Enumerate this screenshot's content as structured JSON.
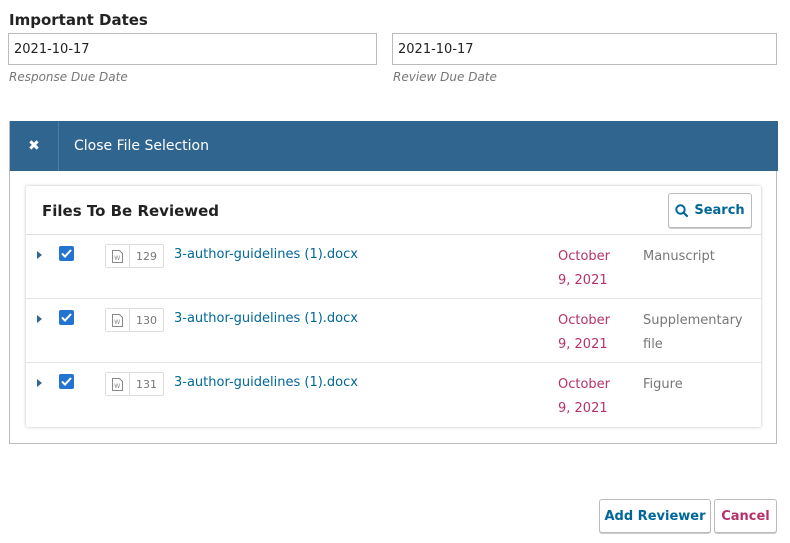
{
  "dates": {
    "title": "Important Dates",
    "response_due": {
      "value": "2021-10-17",
      "help": "Response Due Date"
    },
    "review_due": {
      "value": "2021-10-17",
      "help": "Review Due Date"
    }
  },
  "file_selection": {
    "close_label": "Close File Selection",
    "close_icon": "times-icon",
    "title": "Files To Be Reviewed",
    "search_label": "Search",
    "files": [
      {
        "id": "129",
        "name": "3-author-guidelines (1).docx",
        "date_line1": "October",
        "date_line2": "9, 2021",
        "type_line1": "Manuscript",
        "type_line2": "",
        "checked": true
      },
      {
        "id": "130",
        "name": "3-author-guidelines (1).docx",
        "date_line1": "October",
        "date_line2": "9, 2021",
        "type_line1": "Supplementary",
        "type_line2": "file",
        "checked": true
      },
      {
        "id": "131",
        "name": "3-author-guidelines (1).docx",
        "date_line1": "October",
        "date_line2": "9, 2021",
        "type_line1": "Figure",
        "type_line2": "",
        "checked": true
      }
    ]
  },
  "actions": {
    "add_reviewer_label": "Add Reviewer",
    "cancel_label": "Cancel"
  },
  "colors": {
    "bar": "#306590",
    "link": "#006798",
    "date": "#b5316b",
    "checkbox": "#2374d0"
  }
}
